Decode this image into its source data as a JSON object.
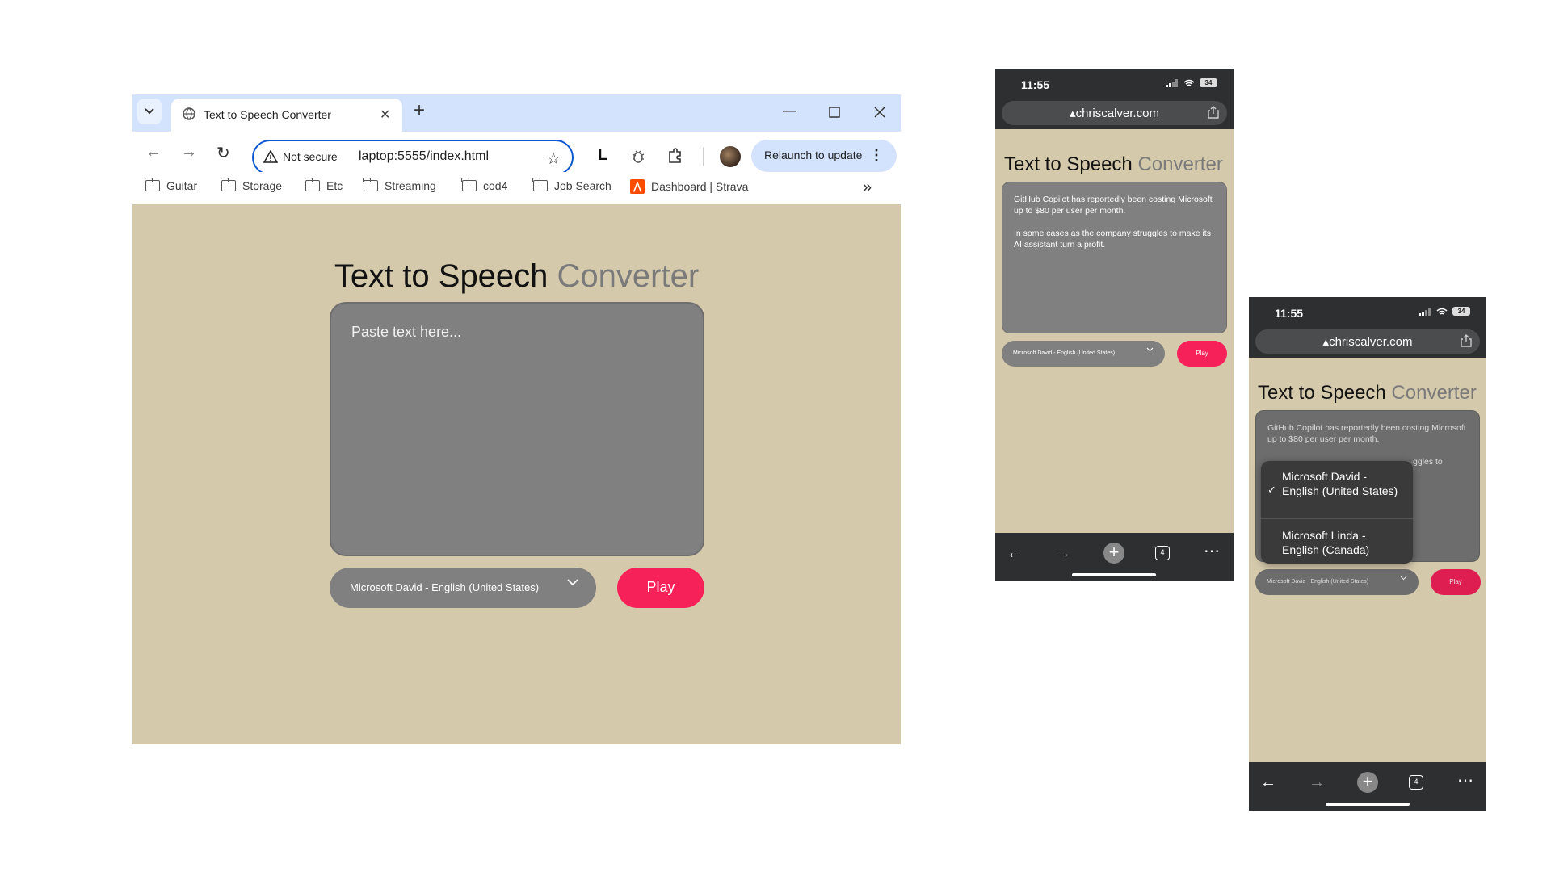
{
  "desktop": {
    "tab": {
      "title": "Text to Speech Converter"
    },
    "omnibox": {
      "security": "Not secure",
      "url": "laptop:5555/index.html"
    },
    "extension_letter": "L",
    "relaunch_label": "Relaunch to update",
    "bookmarks": [
      {
        "label": "Guitar",
        "icon": "folder-icon"
      },
      {
        "label": "Storage",
        "icon": "folder-icon"
      },
      {
        "label": "Etc",
        "icon": "folder-icon"
      },
      {
        "label": "Streaming",
        "icon": "folder-icon"
      },
      {
        "label": "cod4",
        "icon": "folder-icon"
      },
      {
        "label": "Job Search",
        "icon": "folder-icon"
      },
      {
        "label": "Dashboard | Strava",
        "icon": "strava-icon"
      }
    ],
    "page": {
      "title_main": "Text to Speech",
      "title_accent": "Converter",
      "textarea_placeholder": "Paste text here...",
      "voice_selected": "Microsoft David - English (United States)",
      "play_label": "Play"
    }
  },
  "phone1": {
    "time": "11:55",
    "battery": "34",
    "domain": "chriscalver.com",
    "title_main": "Text to Speech",
    "title_accent": "Converter",
    "text_p1": "GitHub Copilot has reportedly been costing Microsoft up to $80 per user per month.",
    "text_p2": "In some cases as the company struggles to make its AI assistant turn a profit.",
    "voice_selected": "Microsoft David - English (United States)",
    "play_label": "Play",
    "tab_count": "4"
  },
  "phone2": {
    "time": "11:55",
    "battery": "34",
    "domain": "chriscalver.com",
    "title_main": "Text to Speech",
    "title_accent": "Converter",
    "text_p1": "GitHub Copilot has reportedly been costing Microsoft up to $80 per user per month.",
    "text_p2_fragment": "ggles to",
    "voice_selected": "Microsoft David - English (United States)",
    "play_label": "Play",
    "tab_count": "4",
    "dropdown_options": [
      {
        "label": "Microsoft David - English (United States)",
        "checked": true
      },
      {
        "label": "Microsoft Linda - English (Canada)",
        "checked": false
      }
    ]
  },
  "colors": {
    "page_bg": "#d5c9ac",
    "textarea_bg": "#808080",
    "play_bg": "#f7215a",
    "tabstrip_bg": "#d3e3fd",
    "omnibox_border": "#0b57d0",
    "phone_chrome": "#2d2f31"
  }
}
